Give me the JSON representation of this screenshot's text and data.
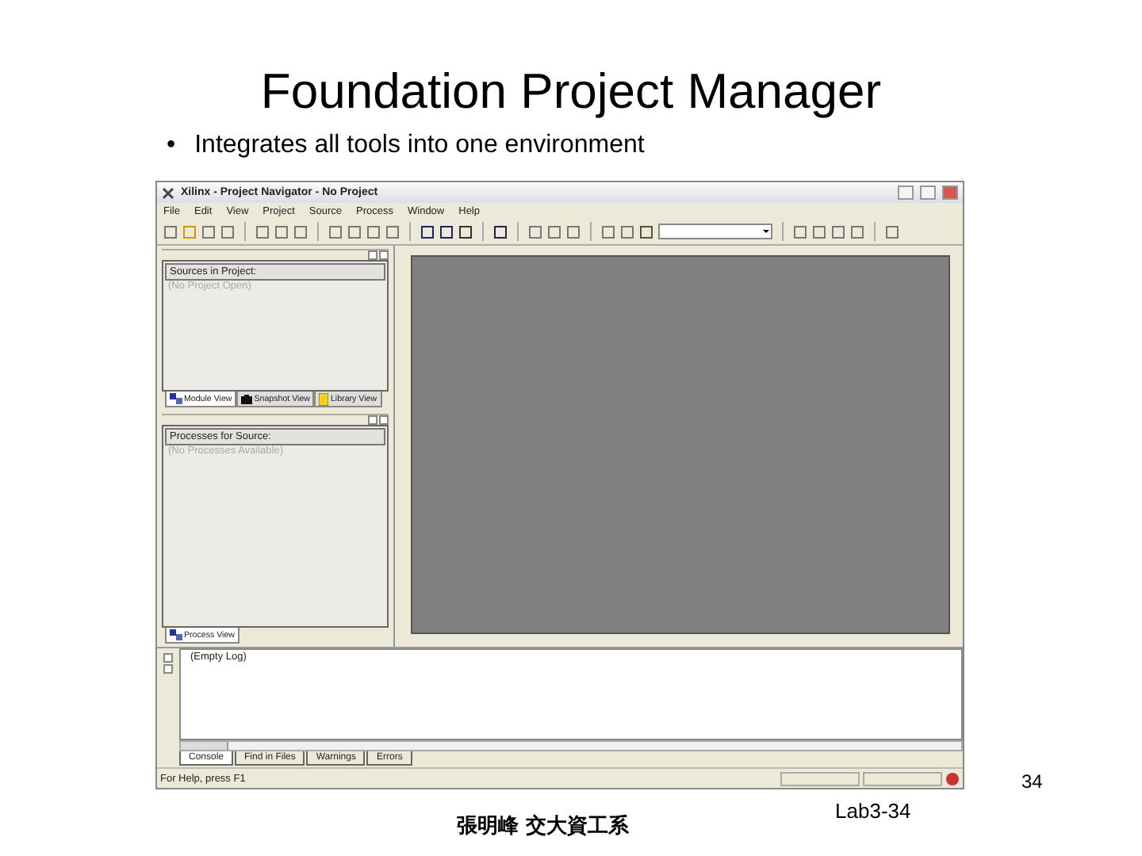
{
  "slide": {
    "title": "Foundation Project Manager",
    "bullets": [
      {
        "marker": "•",
        "text": "Integrates all tools into one environment"
      }
    ],
    "page_number": "34"
  },
  "window": {
    "title": "Xilinx - Project Navigator - No Project",
    "menu": [
      "File",
      "Edit",
      "View",
      "Project",
      "Source",
      "Process",
      "Window",
      "Help"
    ],
    "sources_pane": {
      "header": "Sources in Project:",
      "empty_text": "(No Project Open)",
      "tabs": [
        {
          "label": "Module View",
          "kind": "module",
          "selected": true
        },
        {
          "label": "Snapshot View",
          "kind": "snapshot",
          "selected": false
        },
        {
          "label": "Library View",
          "kind": "library",
          "selected": false
        }
      ]
    },
    "processes_pane": {
      "header": "Processes for Source:",
      "empty_text": "(No Processes Available)",
      "tabs": [
        {
          "label": "Process View",
          "kind": "module",
          "selected": true
        }
      ]
    },
    "log": {
      "text": "(Empty Log)",
      "tabs": [
        {
          "label": "Console",
          "selected": true
        },
        {
          "label": "Find in Files",
          "selected": false
        },
        {
          "label": "Warnings",
          "selected": false
        },
        {
          "label": "Errors",
          "selected": false
        }
      ]
    },
    "status_bar": {
      "text": "For Help, press F1"
    }
  },
  "footer": {
    "author": "張明峰 交大資工系",
    "label": "Lab3-34"
  }
}
